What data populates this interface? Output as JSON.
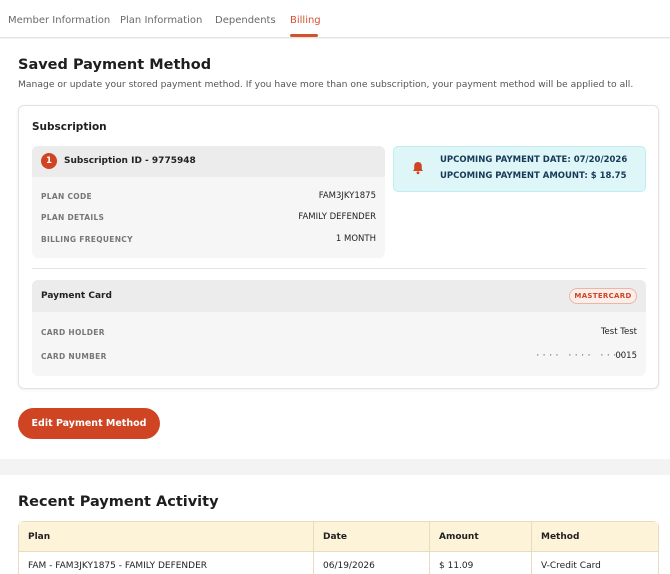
{
  "tabs": [
    {
      "label": "Member Information",
      "active": false
    },
    {
      "label": "Plan Information",
      "active": false
    },
    {
      "label": "Dependents",
      "active": false
    },
    {
      "label": "Billing",
      "active": true
    }
  ],
  "saved_payment": {
    "title": "Saved Payment Method",
    "subtitle": "Manage or update your stored payment method. If you have more than one subscription, your payment method will be applied to all."
  },
  "subscription": {
    "heading": "Subscription",
    "badge_number": "1",
    "id_label": "Subscription ID - 9775948",
    "rows": [
      {
        "label": "PLAN CODE",
        "value": "FAM3JKY1875"
      },
      {
        "label": "PLAN DETAILS",
        "value": "FAMILY DEFENDER"
      },
      {
        "label": "BILLING FREQUENCY",
        "value": "1 MONTH"
      }
    ]
  },
  "upcoming": {
    "icon": "bell-icon",
    "date_line": "UPCOMING PAYMENT DATE: 07/20/2026",
    "amount_line": "UPCOMING PAYMENT AMOUNT: $ 18.75"
  },
  "payment_card": {
    "title": "Payment Card",
    "brand": "MASTERCARD",
    "rows": [
      {
        "label": "CARD HOLDER",
        "value": "Test Test"
      },
      {
        "label": "CARD NUMBER",
        "value": "0015"
      }
    ],
    "mask": "···· ···· ····"
  },
  "edit_button": "Edit Payment Method",
  "recent_activity": {
    "title": "Recent Payment Activity",
    "columns": [
      "Plan",
      "Date",
      "Amount",
      "Method"
    ],
    "rows": [
      [
        "FAM - FAM3JKY1875 - FAMILY DEFENDER",
        "06/19/2026",
        "$ 11.09",
        "V-Credit Card"
      ]
    ]
  },
  "colors": {
    "accent": "#cf4523",
    "alert_bg": "#dff6f8",
    "table_header_bg": "#fdf3d9"
  }
}
